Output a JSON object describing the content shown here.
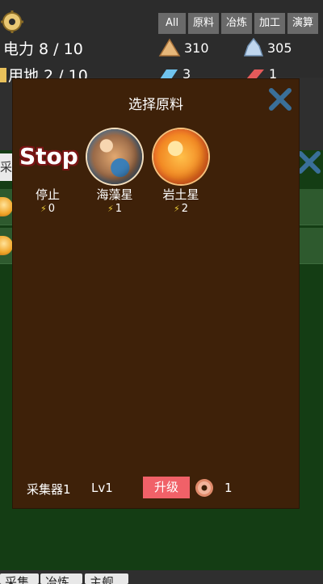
{
  "top": {
    "filters": [
      "All",
      "原料",
      "冶炼",
      "加工",
      "演算"
    ],
    "power": "电力 8 / 10",
    "land": "用地 2 / 10",
    "resources": [
      {
        "icon": "rock-pile-icon",
        "value": "310"
      },
      {
        "icon": "crystal-icon",
        "value": "305"
      },
      {
        "icon": "blue-gem-icon",
        "value": "3"
      },
      {
        "icon": "red-bar-icon",
        "value": "1"
      }
    ]
  },
  "background": {
    "tab_left": "采",
    "bottom_tabs": [
      "采集",
      "冶炼",
      "主舰"
    ]
  },
  "dialog": {
    "title": "选择原料",
    "options": [
      {
        "label": "停止",
        "cost": "0",
        "stop_text": "Stop"
      },
      {
        "label": "海藻星",
        "cost": "1"
      },
      {
        "label": "岩土星",
        "cost": "2"
      }
    ],
    "footer": {
      "collector": "采集器1",
      "level": "Lv1",
      "upgrade_label": "升级",
      "donut_count": "1"
    }
  },
  "colors": {
    "dialog_bg": "#3e2109",
    "upgrade_button": "#f06168",
    "close_icon": "#3a6f99",
    "field_green": "#143d14"
  }
}
